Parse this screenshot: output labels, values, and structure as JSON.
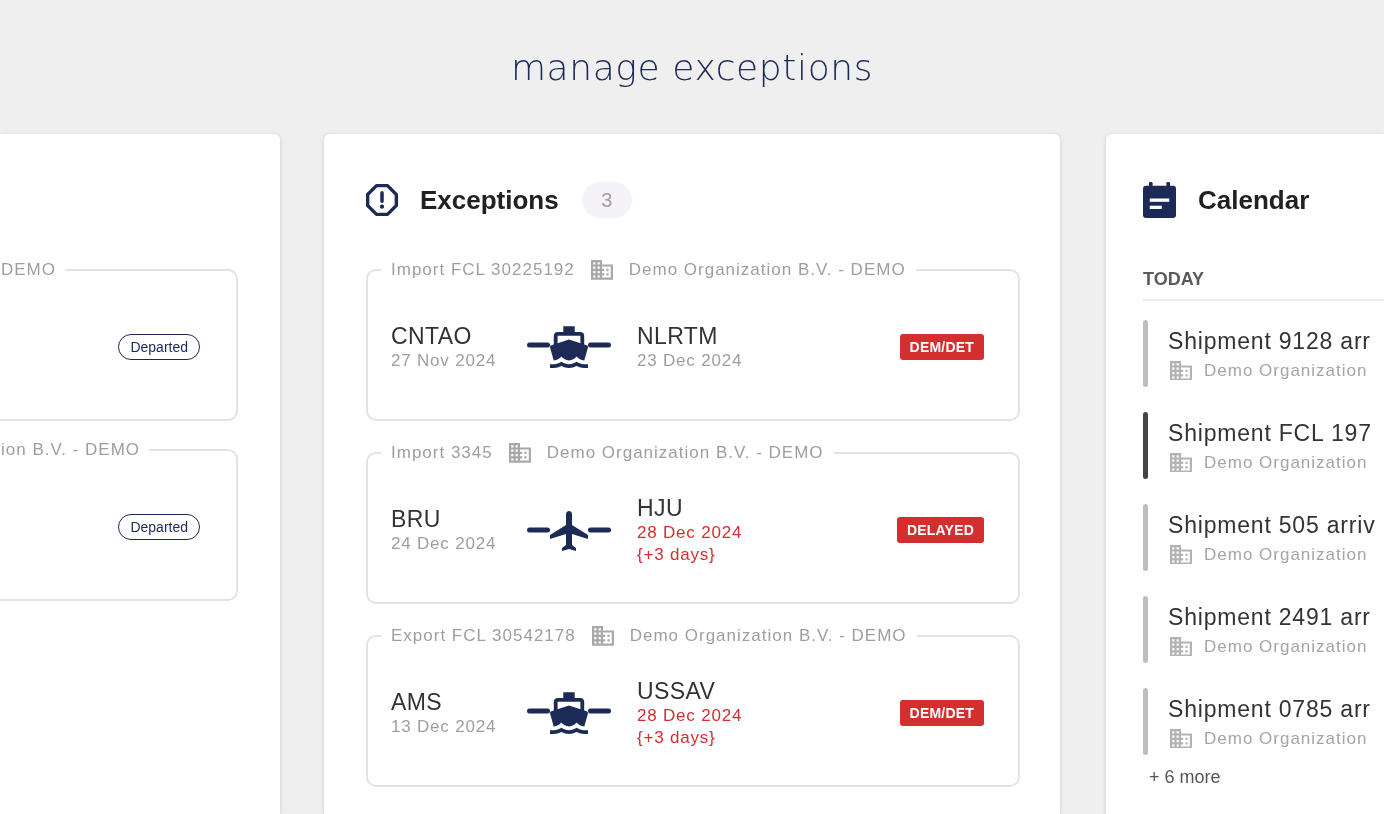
{
  "page_title": "manage exceptions",
  "left_panel": {
    "shipments": [
      {
        "organization": "DEMO",
        "status": "Departed"
      },
      {
        "organization": "ion B.V. - DEMO",
        "status": "Departed"
      }
    ]
  },
  "exceptions": {
    "title": "Exceptions",
    "count": "3",
    "shipments": [
      {
        "reference": "Import FCL 30225192",
        "organization": "Demo Organization B.V. - DEMO",
        "kind": "ship",
        "origin": {
          "code": "CNTAO",
          "date": "27 Nov 2024"
        },
        "destination": {
          "code": "NLRTM",
          "date": "23 Dec 2024",
          "late": false
        },
        "tag": "DEM/DET"
      },
      {
        "reference": "Import 3345",
        "organization": "Demo Organization B.V. - DEMO",
        "kind": "plane",
        "origin": {
          "code": "BRU",
          "date": "24 Dec 2024"
        },
        "destination": {
          "code": "HJU",
          "date": "28 Dec 2024",
          "late": true,
          "delay": "{+3 days}"
        },
        "tag": "DELAYED"
      },
      {
        "reference": "Export FCL 30542178",
        "organization": "Demo Organization B.V. - DEMO",
        "kind": "ship",
        "origin": {
          "code": "AMS",
          "date": "13 Dec 2024"
        },
        "destination": {
          "code": "USSAV",
          "date": "28 Dec 2024",
          "late": true,
          "delay": "{+3 days}"
        },
        "tag": "DEM/DET"
      }
    ]
  },
  "calendar": {
    "title": "Calendar",
    "section": "TODAY",
    "events": [
      {
        "title": "Shipment 9128 arr",
        "organization": "Demo Organization",
        "color": "#bdbdbd"
      },
      {
        "title": "Shipment FCL 197",
        "organization": "Demo Organization",
        "color": "#444444"
      },
      {
        "title": "Shipment 505 arriv",
        "organization": "Demo Organization",
        "color": "#bdbdbd"
      },
      {
        "title": "Shipment 2491 arr",
        "organization": "Demo Organization",
        "color": "#bdbdbd"
      },
      {
        "title": "Shipment 0785 arr",
        "organization": "Demo Organization",
        "color": "#bdbdbd"
      }
    ],
    "more": "+ 6 more"
  }
}
